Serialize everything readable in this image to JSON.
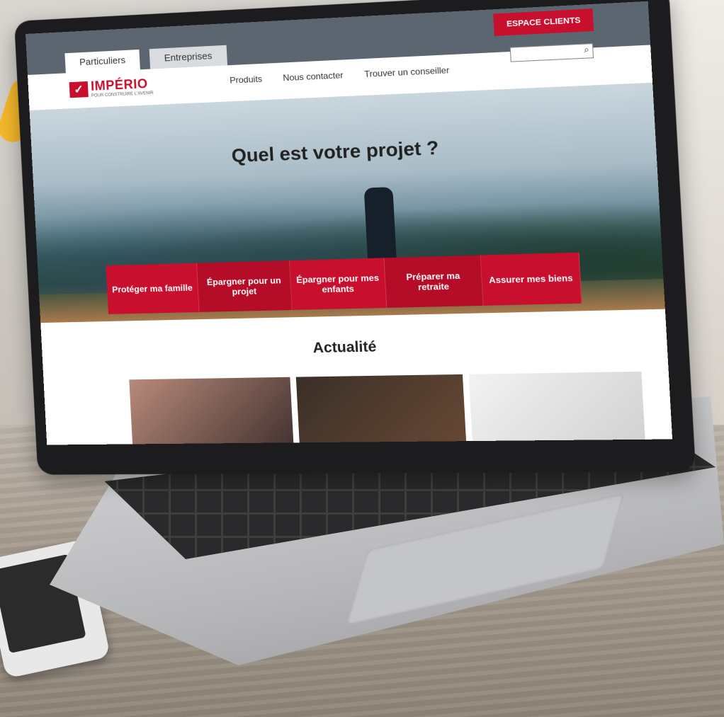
{
  "site": {
    "tabs": [
      {
        "label": "Particuliers",
        "active": true
      },
      {
        "label": "Entreprises",
        "active": false
      }
    ],
    "espace_clients": "ESPACE CLIENTS",
    "logo": {
      "name": "IMPÉRIO",
      "tagline": "POUR CONSTRUIRE L'AVENIR"
    },
    "nav": [
      "Produits",
      "Nous contacter",
      "Trouver un conseiller"
    ],
    "search": {
      "placeholder": ""
    },
    "hero_title": "Quel est votre projet ?",
    "projects": [
      "Protéger ma famille",
      "Épargner pour un projet",
      "Épargner pour mes enfants",
      "Préparer ma retraite",
      "Assurer mes biens"
    ],
    "news_title": "Actualité"
  },
  "colors": {
    "brand_red": "#c8102e",
    "topbar": "#5c6670"
  }
}
